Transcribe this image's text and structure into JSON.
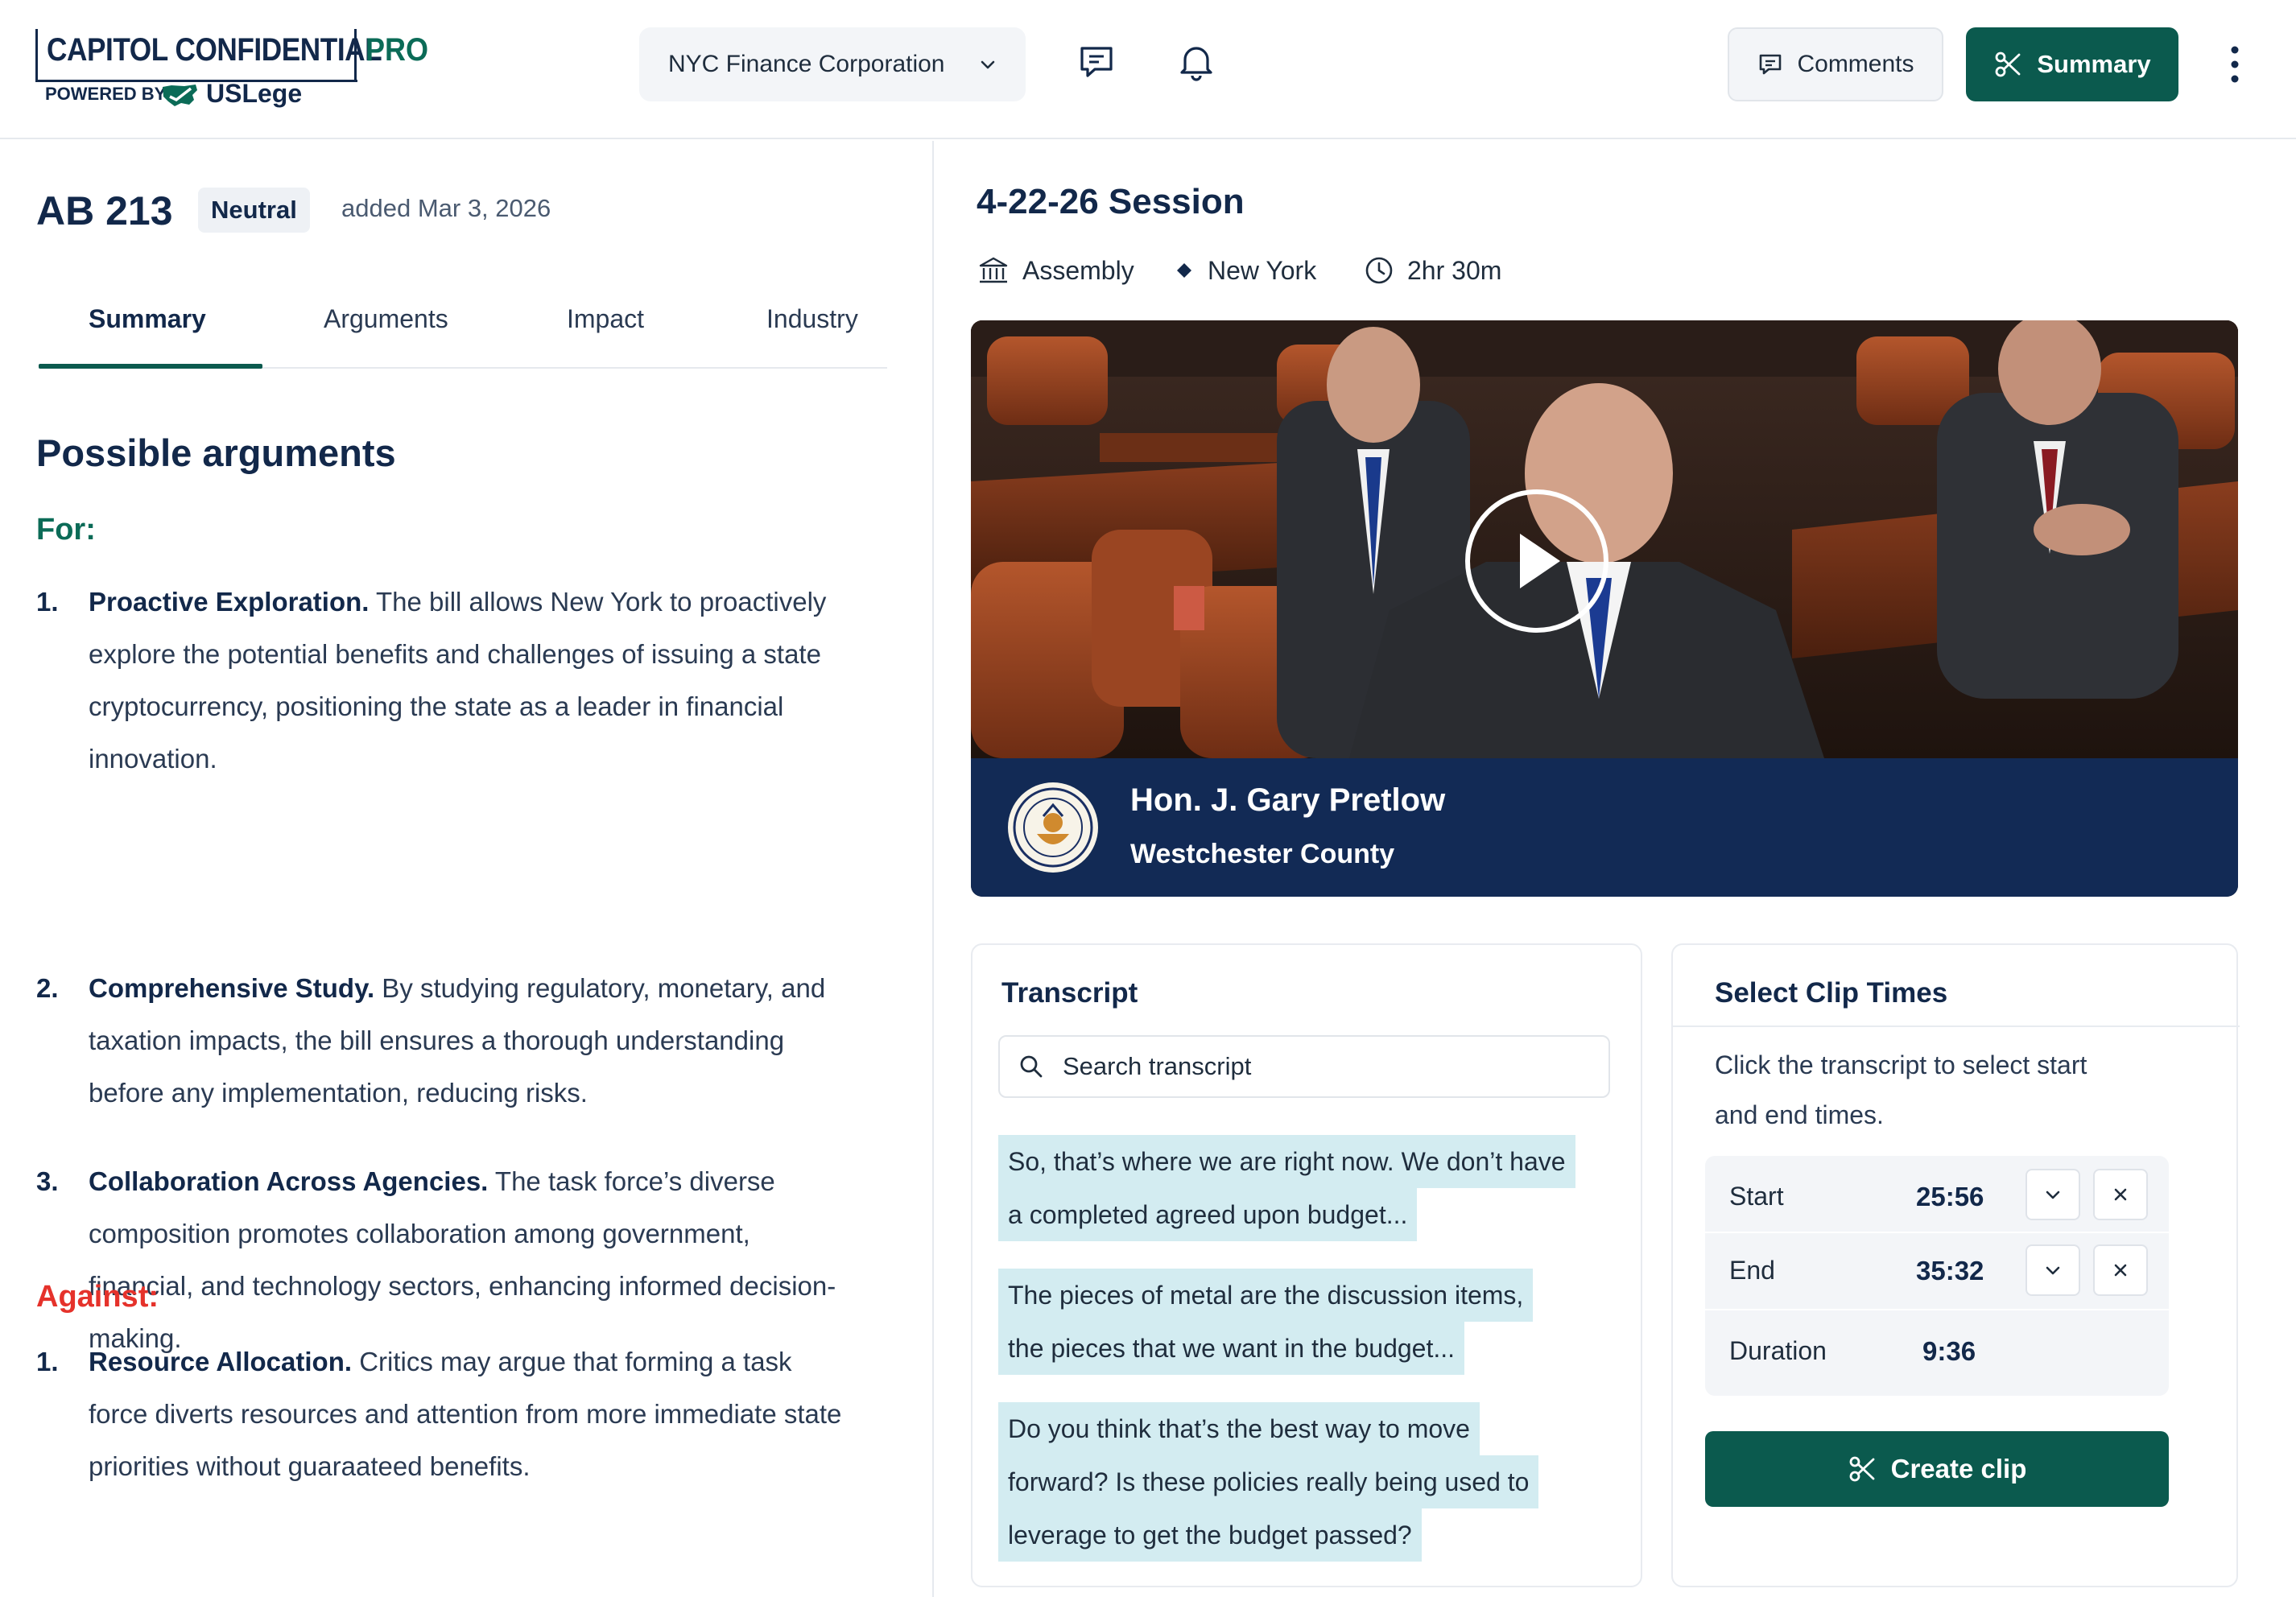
{
  "header": {
    "logo": {
      "name": "CAPITOL CONFIDENTIAL",
      "tier": "PRO",
      "powered_by": "POWERED BY",
      "partner": "USLege"
    },
    "org_selector": {
      "value": "NYC Finance Corporation"
    },
    "icons": [
      "chat-icon",
      "bell-icon",
      "more-vertical-icon"
    ],
    "comments_label": "Comments",
    "summary_label": "Summary"
  },
  "bill": {
    "id": "AB 213",
    "stance": "Neutral",
    "added": "added Mar 3, 2026",
    "tabs": [
      {
        "label": "Summary",
        "active": true
      },
      {
        "label": "Arguments",
        "active": false
      },
      {
        "label": "Impact",
        "active": false
      },
      {
        "label": "Industry",
        "active": false
      }
    ],
    "section_title": "Possible arguments",
    "for_label": "For:",
    "for_args": [
      {
        "num": "1.",
        "title": "Proactive Exploration.",
        "text": " The bill allows New York to proactively explore the potential benefits and challenges of issuing a state cryptocurrency, positioning the state as a leader in financial innovation."
      },
      {
        "num": "2.",
        "title": "Comprehensive Study.",
        "text": " By studying regulatory, monetary, and taxation impacts, the bill ensures a thorough understanding before any implementation, reducing risks."
      },
      {
        "num": "3.",
        "title": "Collaboration Across Agencies.",
        "text": " The task force’s diverse composition promotes collaboration among government, financial, and technology sectors, enhancing informed decision-making."
      }
    ],
    "against_label": "Against:",
    "against_args": [
      {
        "num": "1.",
        "title": "Resource Allocation.",
        "text": " Critics may argue that forming a task force diverts resources and attention from more immediate state priorities without guaraateed benefits."
      }
    ]
  },
  "session": {
    "title": "4-22-26 Session",
    "chamber": "Assembly",
    "state": "New York",
    "duration": "2hr 30m",
    "video": {
      "speaker": "Hon. J. Gary Pretlow",
      "county": "Westchester County"
    }
  },
  "transcript": {
    "title": "Transcript",
    "search_placeholder": "Search transcript",
    "lines": [
      "So, that’s where we are right now. We don’t have",
      "a completed agreed upon budget...",
      "The pieces of metal are the discussion items,",
      "the pieces that we want in the budget...",
      "Do you think that’s the best way to move",
      "forward? Is these policies really being used to",
      "leverage to get the budget passed?"
    ]
  },
  "clip": {
    "title": "Select Clip Times",
    "description": "Click the transcript to select start and end times.",
    "start_label": "Start",
    "start_value": "25:56",
    "end_label": "End",
    "end_value": "35:32",
    "duration_label": "Duration",
    "duration_value": "9:36",
    "create_label": "Create clip"
  },
  "colors": {
    "brand_green": "#0b5a4e",
    "navy": "#12284a",
    "against_red": "#e5322b",
    "highlight": "#d3ecf1"
  }
}
